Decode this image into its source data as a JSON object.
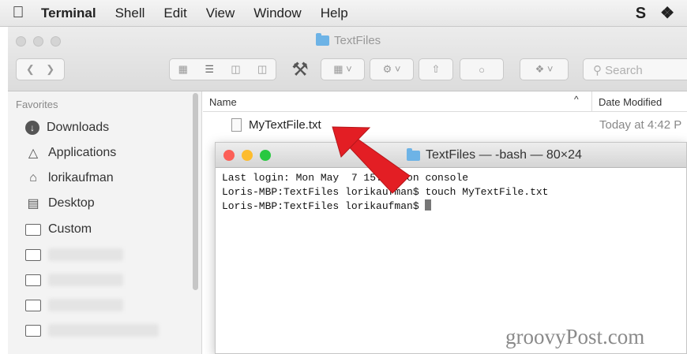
{
  "menubar": {
    "app": "Terminal",
    "items": [
      "Shell",
      "Edit",
      "View",
      "Window",
      "Help"
    ]
  },
  "finder": {
    "title": "TextFiles",
    "search_placeholder": "Search",
    "sidebar": {
      "heading": "Favorites",
      "items": [
        {
          "label": "Downloads",
          "icon": "downloads-icon"
        },
        {
          "label": "Applications",
          "icon": "applications-icon"
        },
        {
          "label": "lorikaufman",
          "icon": "home-icon"
        },
        {
          "label": "Desktop",
          "icon": "desktop-icon"
        },
        {
          "label": "Custom",
          "icon": "folder-icon"
        }
      ]
    },
    "columns": {
      "name": "Name",
      "date": "Date Modified"
    },
    "files": [
      {
        "name": "MyTextFile.txt",
        "date": "Today at 4:42 P"
      }
    ]
  },
  "terminal": {
    "title": "TextFiles — -bash — 80×24",
    "lines": [
      "Last login: Mon May  7 15:5   on console",
      "Loris-MBP:TextFiles lorikaufman$ touch MyTextFile.txt",
      "Loris-MBP:TextFiles lorikaufman$ "
    ]
  },
  "watermark": "groovyPost.com",
  "colors": {
    "arrow": "#e31e24",
    "close": "#fc5f57",
    "minimize": "#fdbc2e",
    "zoom": "#28c840"
  }
}
